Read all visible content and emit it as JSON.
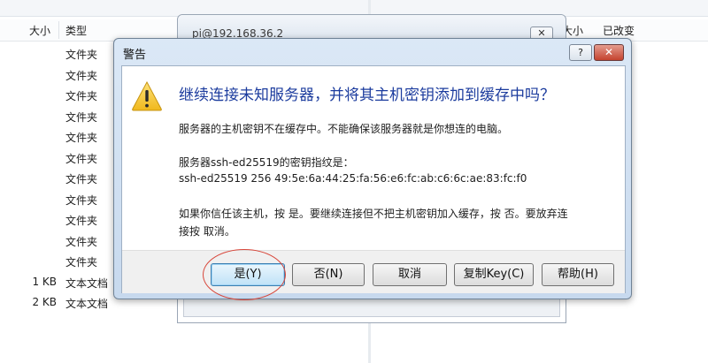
{
  "background": {
    "left_pane": {
      "col_size": "大小",
      "col_type": "类型",
      "rows": [
        {
          "size": "",
          "type": "文件夹"
        },
        {
          "size": "",
          "type": "文件夹"
        },
        {
          "size": "",
          "type": "文件夹"
        },
        {
          "size": "",
          "type": "文件夹"
        },
        {
          "size": "",
          "type": "文件夹"
        },
        {
          "size": "",
          "type": "文件夹"
        },
        {
          "size": "",
          "type": "文件夹"
        },
        {
          "size": "",
          "type": "文件夹"
        },
        {
          "size": "",
          "type": "文件夹"
        },
        {
          "size": "",
          "type": "文件夹"
        },
        {
          "size": "",
          "type": "文件夹"
        },
        {
          "size": "1 KB",
          "type": "文本文档"
        },
        {
          "size": "2 KB",
          "type": "文本文档"
        }
      ]
    },
    "right_pane": {
      "col_size": "大小",
      "col_modified": "已改变"
    },
    "behind_window": {
      "title": "pi@192.168.36.2",
      "close_glyph": "✕"
    }
  },
  "dialog": {
    "title": "警告",
    "help_glyph": "?",
    "close_glyph": "✕",
    "icon": "warning-triangle-icon",
    "heading": "继续连接未知服务器，并将其主机密钥添加到缓存中吗？",
    "message_line1": "服务器的主机密钥不在缓存中。不能确保该服务器就是你想连的电脑。",
    "message_line2": "服务器ssh-ed25519的密钥指纹是：",
    "message_line3": "ssh-ed25519 256 49:5e:6a:44:25:fa:56:e6:fc:ab:c6:6c:ae:83:fc:f0",
    "message_line4": "如果你信任该主机，按 是。要继续连接但不把主机密钥加入缓存，按 否。要放弃连",
    "message_line5": "接按 取消。",
    "buttons": {
      "yes": "是(Y)",
      "no": "否(N)",
      "cancel": "取消",
      "copy_key": "复制Key(C)",
      "help": "帮助(H)"
    }
  },
  "colors": {
    "heading": "#1c3c9e",
    "annotation_ring": "#d8463a",
    "warning_yellow": "#f7c43a"
  }
}
